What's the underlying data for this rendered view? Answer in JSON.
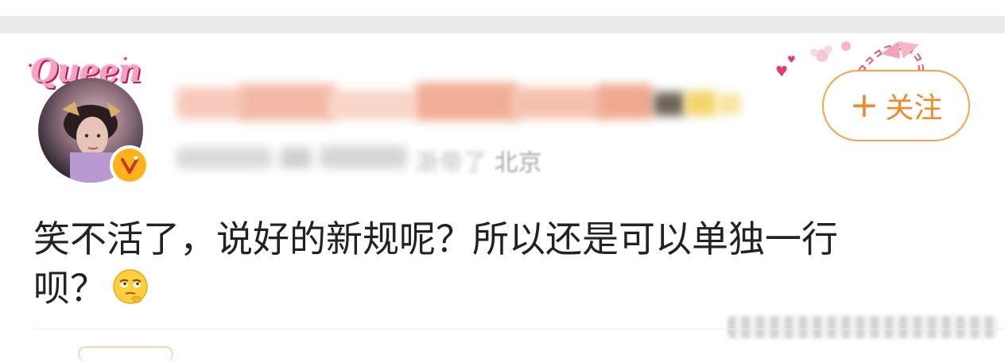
{
  "badge": {
    "text": "Queen"
  },
  "header": {
    "location_text": "北京",
    "follow_label": "关注",
    "follow_plus": "+"
  },
  "comment": {
    "line1": "笑不活了，说好的新规呢？所以还是可以单独一行",
    "line2": "呗？",
    "emoji_name": "thinking-eye-roll-emoji"
  },
  "colors": {
    "accent_orange": "#f08a2b",
    "button_border": "#f8a34c",
    "verified_gold": "#ffb21a",
    "badge_pink": "#f2a3bf",
    "text_primary": "#222222",
    "text_secondary": "#a8a8a8"
  }
}
